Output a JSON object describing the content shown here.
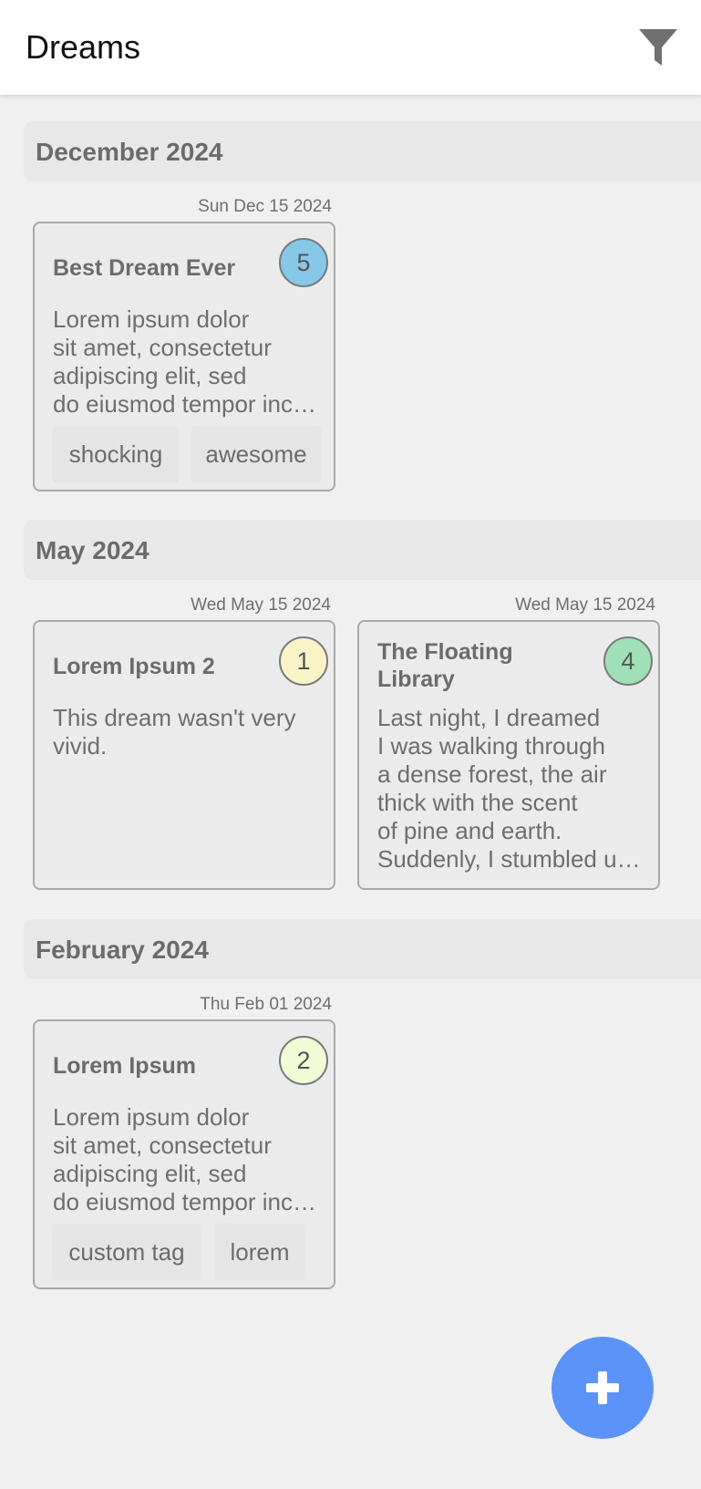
{
  "app": {
    "title": "Dreams",
    "filter_icon": "filter-icon",
    "add_icon": "plus-icon",
    "accent_color": "#5b93f8"
  },
  "sections": [
    {
      "header": "December 2024",
      "dreams": [
        {
          "date": "Sun Dec 15 2024",
          "title": "Best Dream Ever",
          "rating": "5",
          "rating_color": "#87c8e9",
          "body_lines": [
            "Lorem ipsum dolor",
            "sit amet, consectetur",
            "adipiscing elit, sed",
            "do eiusmod tempor incididunt"
          ],
          "tags": [
            "shocking",
            "awesome"
          ]
        }
      ]
    },
    {
      "header": "May 2024",
      "dreams": [
        {
          "date": "Wed May 15 2024",
          "title": "Lorem Ipsum 2",
          "rating": "1",
          "rating_color": "#fbf3c8",
          "body_lines": [
            "This dream wasn't very",
            "vivid."
          ],
          "tags": []
        },
        {
          "date": "Wed May 15 2024",
          "title_lines": [
            "The Floating",
            "Library"
          ],
          "rating": "4",
          "rating_color": "#9fe0b6",
          "body_lines": [
            "Last night, I dreamed",
            "I was walking through",
            "a dense forest, the air",
            "thick with the scent",
            "of pine and earth.",
            "Suddenly, I stumbled upon"
          ],
          "tags": []
        }
      ]
    },
    {
      "header": "February 2024",
      "dreams": [
        {
          "date": "Thu Feb 01 2024",
          "title": "Lorem Ipsum",
          "rating": "2",
          "rating_color": "#f1fbd5",
          "body_lines": [
            "Lorem ipsum dolor",
            "sit amet, consectetur",
            "adipiscing elit, sed",
            "do eiusmod tempor incididunt"
          ],
          "tags": [
            "custom tag",
            "lorem"
          ]
        }
      ]
    }
  ]
}
